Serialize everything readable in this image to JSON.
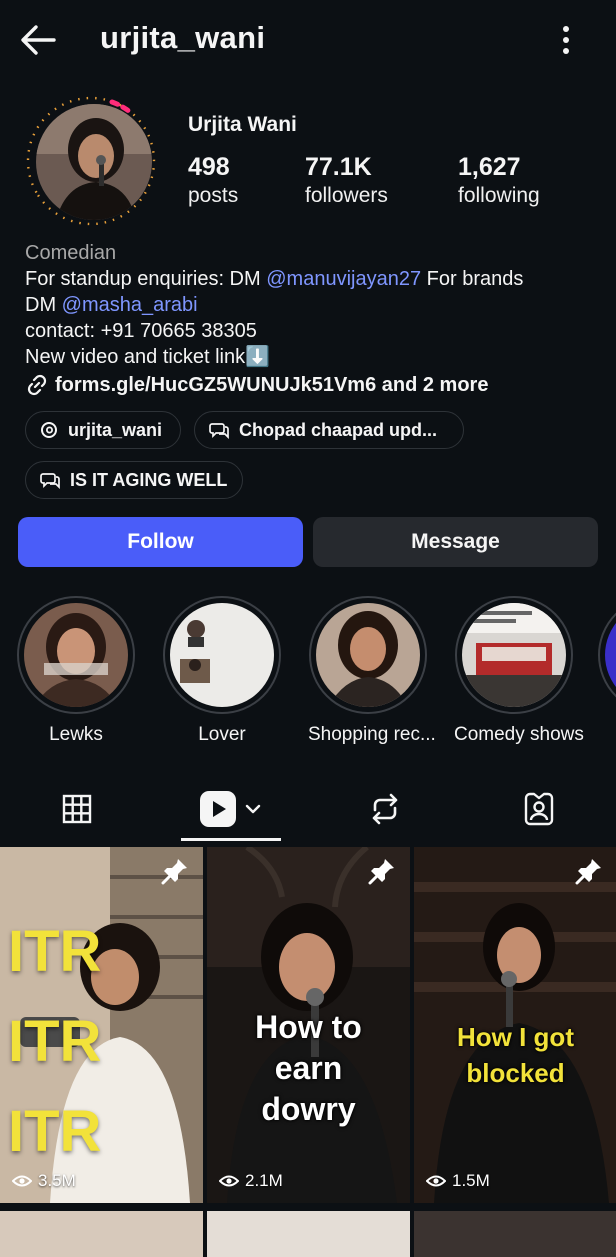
{
  "header": {
    "username": "urjita_wani",
    "back_icon": "arrow-left-icon",
    "more_icon": "more-vertical-icon"
  },
  "profile": {
    "display_name": "Urjita Wani",
    "stats": {
      "posts": {
        "value": "498",
        "label": "posts"
      },
      "followers": {
        "value": "77.1K",
        "label": "followers"
      },
      "following": {
        "value": "1,627",
        "label": "following"
      }
    }
  },
  "bio": {
    "category": "Comedian",
    "line1_prefix": "For standup enquiries: DM ",
    "line1_mention": "manuvijayan27",
    "line1_suffix": " For brands",
    "line2_prefix": "DM ",
    "line2_mention": "masha_arabi",
    "line3": "contact: +91 70665 38305",
    "line4": "New video and ticket link⬇️",
    "link": "forms.gle/HucGZ5WUNUJk51Vm6 and 2 more"
  },
  "chips": [
    {
      "label": "urjita_wani",
      "icon": "threads-icon"
    },
    {
      "label": "Chopad chaapad upd...",
      "icon": "broadcast-channel-icon"
    },
    {
      "label": "IS IT AGING WELL",
      "icon": "broadcast-channel-icon"
    }
  ],
  "actions": {
    "follow_label": "Follow",
    "message_label": "Message"
  },
  "highlights": [
    {
      "label": "Lewks"
    },
    {
      "label": "Lover"
    },
    {
      "label": "Shopping rec..."
    },
    {
      "label": "Comedy shows"
    }
  ],
  "tabs": [
    {
      "name": "grid",
      "icon": "grid-icon"
    },
    {
      "name": "reels",
      "icon": "reels-icon",
      "selected": true
    },
    {
      "name": "reposts",
      "icon": "repost-icon"
    },
    {
      "name": "tagged",
      "icon": "tagged-icon"
    }
  ],
  "grid": [
    {
      "views": "3.5M",
      "overlay_lines": [
        "ITR",
        "ITR",
        "ITR"
      ],
      "pinned": true
    },
    {
      "views": "2.1M",
      "overlay_lines": [
        "How to",
        "earn",
        "dowry"
      ],
      "pinned": true
    },
    {
      "views": "1.5M",
      "overlay_lines": [
        "How I got",
        "blocked"
      ],
      "pinned": true
    }
  ],
  "colors": {
    "background": "#0c1014",
    "follow_button": "#4a5df9",
    "message_button": "#26292e",
    "mention": "#7f96ff",
    "story_ring_accent": "#ff2d7a"
  }
}
